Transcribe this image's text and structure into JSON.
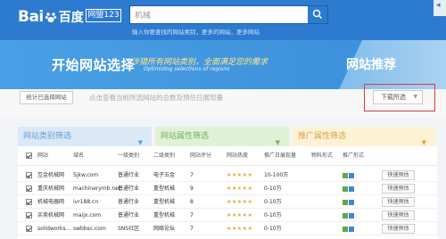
{
  "header": {
    "logo_text": "Bai",
    "logo_cn": "百度",
    "badge": "网盟123",
    "search_value": "机械",
    "hint": "输入你要查找的网站类别，更多的网站，更多网站"
  },
  "banner": {
    "title": "开始网站选择",
    "subtitle": "涉猎所有网站类别，全面满足您的需求",
    "subtitle_en": "Optimizing selections of regions",
    "right": "网站推荐"
  },
  "filter": {
    "stat_button": "统计已选择网站",
    "hint": "点击查看当前所选网站的总数及预估日展现量",
    "download": "下载所选"
  },
  "categories": [
    {
      "label": "网站类别筛选"
    },
    {
      "label": "网站属性筛选"
    },
    {
      "label": "推广属性筛选"
    }
  ],
  "table": {
    "headers": [
      "网站",
      "域名",
      "一级类别",
      "二级类别",
      "网站评分",
      "网站热度",
      "推广日展现量",
      "物料形式",
      "推广形式"
    ],
    "rows": [
      {
        "site": "互金机械网",
        "domain": "5jkw.com",
        "cat1": "普通行业",
        "cat2": "电子五金",
        "score": "7",
        "stars": "★★★★★",
        "range": "10-100万",
        "action": "快速预估"
      },
      {
        "site": "重庆机械网",
        "domain": "machinerymb.net",
        "cat1": "普通行业",
        "cat2": "重型机械",
        "score": "9",
        "stars": "★★★★★",
        "range": "0-10万",
        "action": "快速预估"
      },
      {
        "site": "机械电器网",
        "domain": "ivr188.cn",
        "cat1": "普通行业",
        "cat2": "重型机械",
        "score": "8",
        "stars": "★★★★★",
        "range": "0-10万",
        "action": "快速预估"
      },
      {
        "site": "买卖机械网",
        "domain": "maijx.com",
        "cat1": "普通行业",
        "cat2": "重型机械",
        "score": "7",
        "stars": "★★★★★",
        "range": "0-10万",
        "action": "快速预估"
      },
      {
        "site": "solidworks...",
        "domain": "swbbsc.com",
        "cat1": "SNS社区",
        "cat2": "网络论坛",
        "score": "7",
        "stars": "★★★★★",
        "range": "0-10万",
        "action": "快速预估"
      }
    ]
  },
  "colors": {
    "header_blue": "#2d7bd0",
    "highlight_red": "#e0383e"
  }
}
